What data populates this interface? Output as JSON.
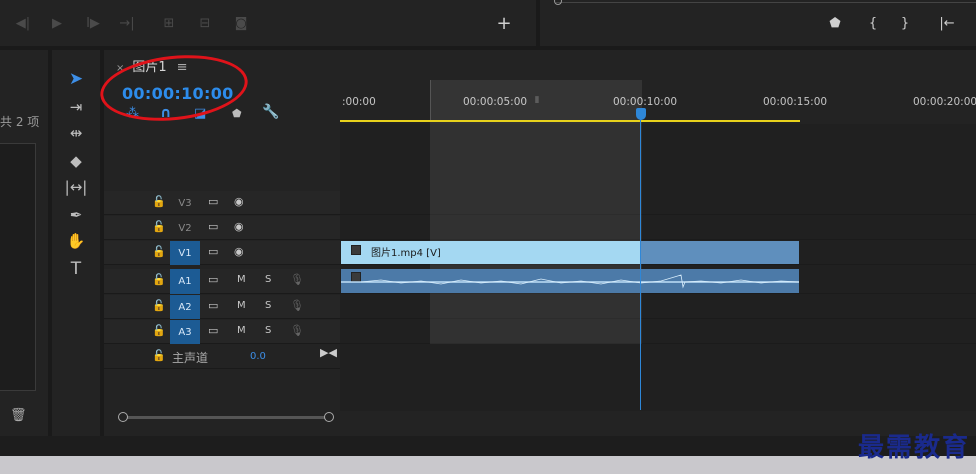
{
  "project_panel": {
    "item_count": "共 2 项"
  },
  "sequence": {
    "tab_title": "图片1",
    "close": "×",
    "menu": "≡",
    "timecode": "00:00:10:00"
  },
  "ruler": {
    "ticks": [
      ":00:00",
      "00:00:05:00",
      "00:00:10:00",
      "00:00:15:00",
      "00:00:20:00"
    ]
  },
  "tracks": {
    "video": [
      {
        "label": "V3"
      },
      {
        "label": "V2"
      },
      {
        "label": "V1"
      }
    ],
    "audio": [
      {
        "label": "A1",
        "m": "M",
        "s": "S"
      },
      {
        "label": "A2",
        "m": "M",
        "s": "S"
      },
      {
        "label": "A3",
        "m": "M",
        "s": "S"
      }
    ],
    "master": {
      "label": "主声道",
      "value": "0.0"
    }
  },
  "clips": {
    "video_name": "图片1.mp4 [V]"
  },
  "watermark": "最需教育",
  "icons": {
    "transport": [
      "mark-in-icon",
      "step-back-icon",
      "play-icon",
      "step-forward-icon",
      "go-to-out-icon",
      "lift-icon",
      "extract-icon",
      "export-frame-icon",
      "add-icon"
    ],
    "tools": [
      "selection-tool-icon",
      "track-select-icon",
      "ripple-edit-icon",
      "razor-icon",
      "slip-icon",
      "pen-icon",
      "hand-icon",
      "type-icon"
    ]
  },
  "colors": {
    "timecode": "#2d8ceb",
    "playhead": "#2e87d8",
    "work_area": "#e8d21c",
    "video_clip": "#a4d8f2",
    "audio_clip": "#4c7aa8",
    "annotation": "#e0131a"
  }
}
